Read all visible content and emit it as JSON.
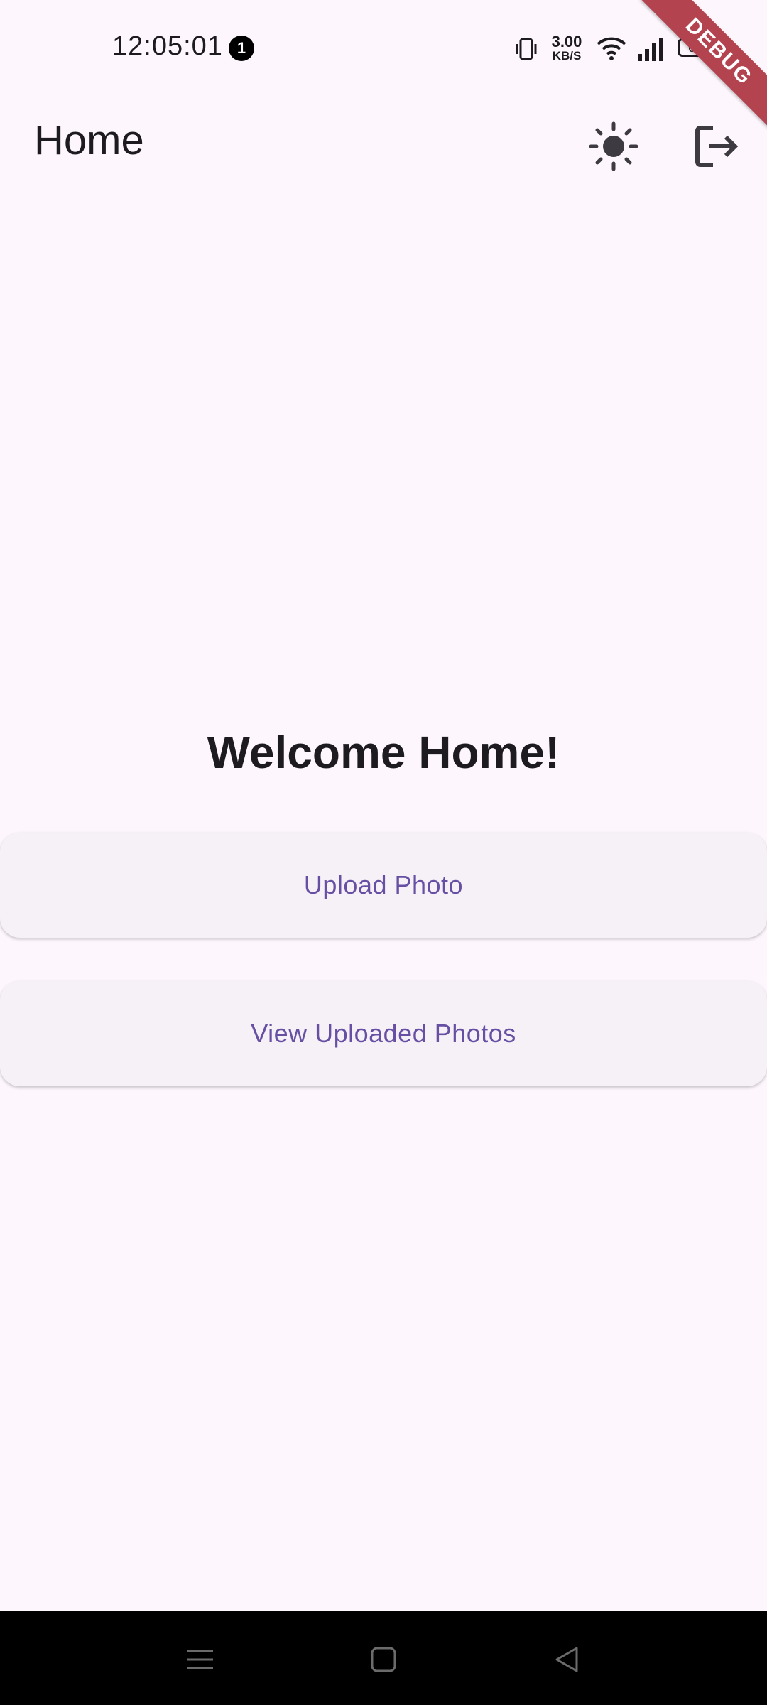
{
  "status_bar": {
    "time": "12:05:01",
    "notification_count": "1",
    "net_speed_value": "3.00",
    "net_speed_unit": "KB/S",
    "battery": "61"
  },
  "debug_banner": "DEBUG",
  "app_bar": {
    "title": "Home",
    "icons": [
      "sun-icon",
      "logout-icon"
    ]
  },
  "main": {
    "heading": "Welcome Home!",
    "buttons": {
      "upload": "Upload Photo",
      "view": "View Uploaded Photos"
    }
  },
  "nav_bar": {
    "icons": [
      "menu-icon",
      "home-icon",
      "back-icon"
    ]
  },
  "colors": {
    "background": "#fdf7fd",
    "button_background": "#f6f1f7",
    "accent": "#6750a4",
    "debug_ribbon": "#b3434f"
  }
}
